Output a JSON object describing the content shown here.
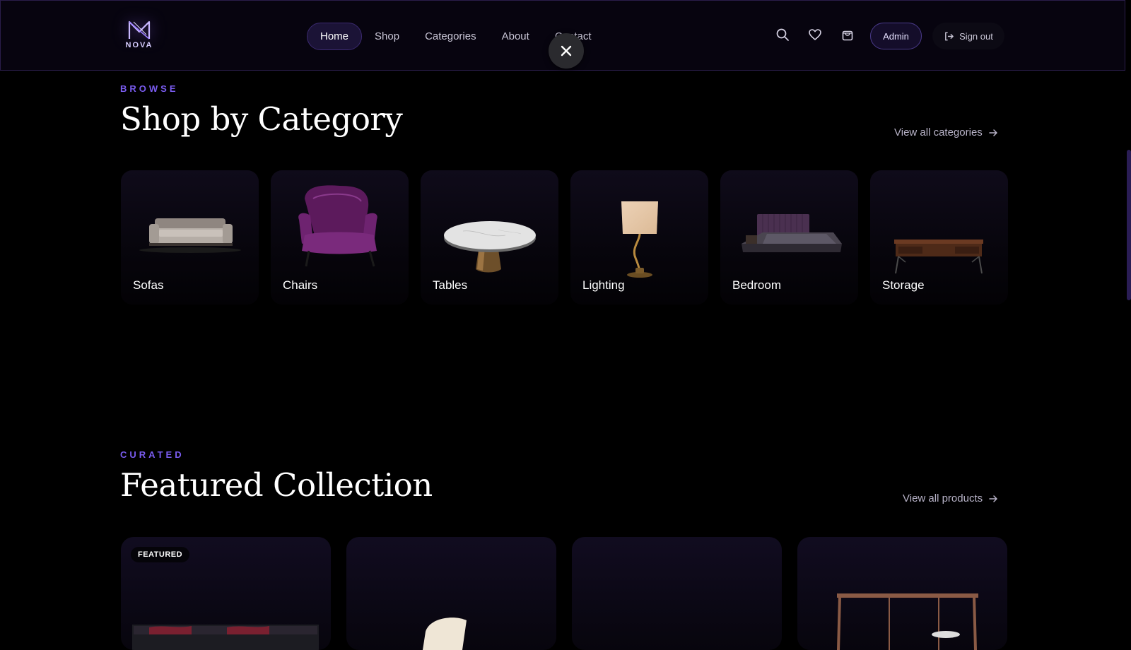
{
  "brand": {
    "name": "NOVA",
    "accent": "#7a5cf0"
  },
  "nav": {
    "links": [
      {
        "label": "Home",
        "active": true
      },
      {
        "label": "Shop",
        "active": false
      },
      {
        "label": "Categories",
        "active": false
      },
      {
        "label": "About",
        "active": false
      },
      {
        "label": "Contact",
        "active": false
      }
    ],
    "icons": [
      "search-icon",
      "heart-icon",
      "shopping-bag-icon"
    ],
    "admin_label": "Admin",
    "signout_label": "Sign out"
  },
  "categories_section": {
    "eyebrow": "BROWSE",
    "title": "Shop by Category",
    "view_all": "View all categories",
    "items": [
      {
        "label": "Sofas",
        "icon": "sofa"
      },
      {
        "label": "Chairs",
        "icon": "armchair"
      },
      {
        "label": "Tables",
        "icon": "table"
      },
      {
        "label": "Lighting",
        "icon": "lamp"
      },
      {
        "label": "Bedroom",
        "icon": "bed"
      },
      {
        "label": "Storage",
        "icon": "desk"
      }
    ]
  },
  "featured_section": {
    "eyebrow": "CURATED",
    "title": "Featured Collection",
    "view_all": "View all products",
    "badge": "FEATURED"
  }
}
